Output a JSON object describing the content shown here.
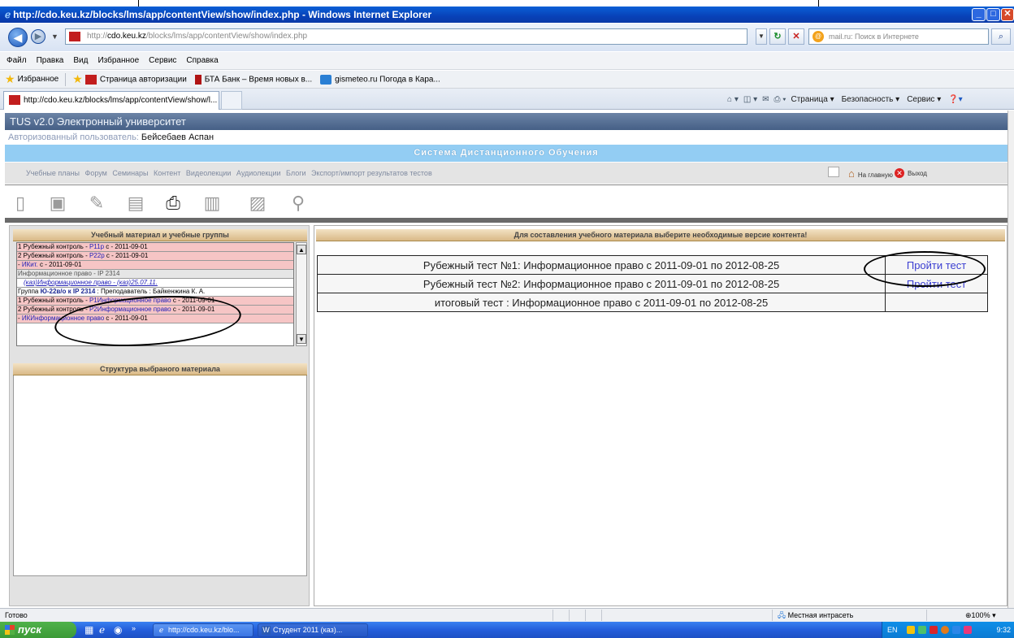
{
  "window": {
    "title": "http://cdo.keu.kz/blocks/lms/app/contentView/show/index.php - Windows Internet Explorer",
    "min": "_",
    "max": "□",
    "close": "✕"
  },
  "address": {
    "prefix": "http://",
    "host": "cdo.keu.kz",
    "path": "/blocks/lms/app/contentView/show/index.php",
    "search_placeholder": "mail.ru: Поиск в Интернете"
  },
  "menu": [
    "Файл",
    "Правка",
    "Вид",
    "Избранное",
    "Сервис",
    "Справка"
  ],
  "favorites": {
    "label": "Избранное",
    "items": [
      "Страница авторизации",
      "БТА Банк – Время новых в...",
      "gismeteo.ru Погода в Кара..."
    ]
  },
  "tab": {
    "title": "http://cdo.keu.kz/blocks/lms/app/contentView/show/l..."
  },
  "commands": [
    "Страница ▾",
    "Безопасность ▾",
    "Сервис ▾"
  ],
  "page": {
    "header": "TUS v2.0 Электронный университет",
    "user_label": "Авторизованный пользователь: ",
    "user_name": "Бейсебаев Аспан",
    "system_title": "Система Дистанционного Обучения",
    "nav": [
      "Учебные планы",
      "Форум",
      "Семинары",
      "Контент",
      "Видеолекции",
      "Аудиолекции",
      "Блоги",
      "Экспорт/импорт результатов тестов"
    ],
    "home": "На главную",
    "exit": "Выход"
  },
  "left_panel": {
    "title": "Учебный материал и учебные группы",
    "structure_title": "Структура выбраного материала",
    "rows": [
      {
        "pre": "1 Рубежный контроль - ",
        "link": "Р11р",
        "post": " с - 2011-09-01"
      },
      {
        "pre": "2 Рубежный контроль - ",
        "link": "Р22р",
        "post": " с - 2011-09-01"
      },
      {
        "pre": "- ",
        "link": "ИКит.",
        "post": " с - 2011-09-01"
      },
      {
        "pre": "Информационное право - IP 2314",
        "link": "",
        "post": ""
      },
      {
        "pre": "",
        "link": "(каз)Информационное право - (каз)25.07.11.",
        "post": ""
      },
      {
        "pre": "Группа ",
        "link": "Ю-22в/о к IP 2314",
        "post": " : Преподаватель : Байкенжина К. А."
      },
      {
        "pre": "1 Рубежный контроль - ",
        "link": "Р1Информационное право",
        "post": " с - 2011-09-01"
      },
      {
        "pre": "2 Рубежный контроль - ",
        "link": "Р2Информационное право",
        "post": " с - 2011-09-01"
      },
      {
        "pre": "- ",
        "link": "ИКИнформационное право",
        "post": " с - 2011-09-01"
      }
    ]
  },
  "right_panel": {
    "title": "Для составления учебного материала выберите необходимые версие контента!",
    "tests": [
      {
        "name": "Рубежный тест №1: Информационное право   с 2011-09-01 по 2012-08-25",
        "action": "Пройти тест"
      },
      {
        "name": "Рубежный тест №2: Информационное право   с 2011-09-01 по 2012-08-25",
        "action": "Пройти тест"
      },
      {
        "name": "итоговый тест : Информационное право   с 2011-09-01 по 2012-08-25",
        "action": ""
      }
    ]
  },
  "status": {
    "text": "Готово",
    "zone": "Местная интрасеть",
    "zoom": "100%"
  },
  "taskbar": {
    "start": "пуск",
    "tasks": [
      "http://cdo.keu.kz/blo...",
      "Студент 2011 (каз)..."
    ],
    "lang": "EN",
    "clock": "9:32"
  },
  "colors": {
    "titlebar": "#0842b8",
    "system_bar": "#93cdf3",
    "pink_row": "#f6c5c5",
    "link": "#3b3ed1"
  }
}
